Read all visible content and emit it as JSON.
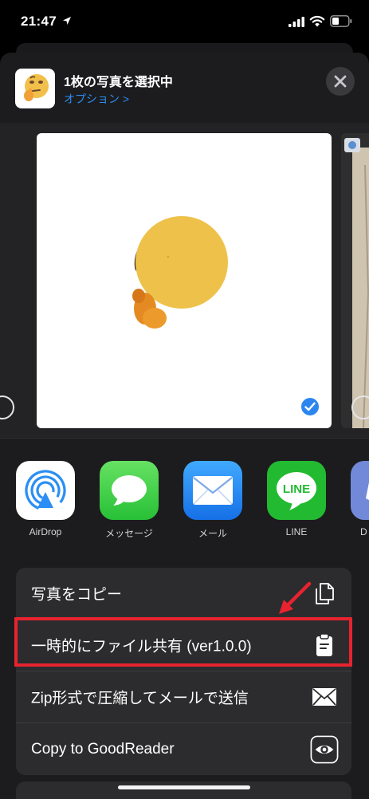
{
  "status": {
    "time": "21:47"
  },
  "header": {
    "title": "1枚の写真を選択中",
    "options_label": "オプション >"
  },
  "apps": [
    {
      "label": "AirDrop",
      "icon": "airdrop-icon"
    },
    {
      "label": "メッセージ",
      "icon": "messages-icon"
    },
    {
      "label": "メール",
      "icon": "mail-icon"
    },
    {
      "label": "LINE",
      "icon": "line-icon",
      "icon_text": "LINE"
    },
    {
      "label": "D",
      "icon": "discord-icon"
    }
  ],
  "actions": [
    {
      "label": "写真をコピー",
      "icon": "copy-icon"
    },
    {
      "label": "一時的にファイル共有 (ver1.0.0)",
      "icon": "clipboard-icon"
    },
    {
      "label": "Zip形式で圧縮してメールで送信",
      "icon": "envelope-icon"
    },
    {
      "label": "Copy to GoodReader",
      "icon": "goodreader-icon"
    }
  ],
  "colors": {
    "accent": "#2c8cf5",
    "highlight": "#e8232f",
    "sheet": "#1c1c1e",
    "action_bg": "#2c2c2e"
  }
}
